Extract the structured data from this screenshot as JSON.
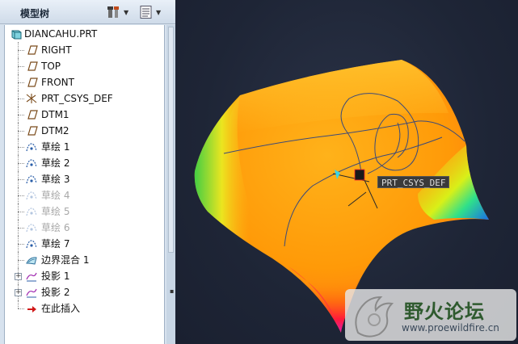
{
  "panel": {
    "title": "模型树",
    "settings_icon": "tree-settings-icon",
    "filter_icon": "tree-filter-icon"
  },
  "tree": {
    "root": {
      "label": "DIANCAHU.PRT",
      "icon": "part-icon"
    },
    "items": [
      {
        "label": "RIGHT",
        "icon": "datum-plane-icon",
        "suppressed": false,
        "expandable": false
      },
      {
        "label": "TOP",
        "icon": "datum-plane-icon",
        "suppressed": false,
        "expandable": false
      },
      {
        "label": "FRONT",
        "icon": "datum-plane-icon",
        "suppressed": false,
        "expandable": false
      },
      {
        "label": "PRT_CSYS_DEF",
        "icon": "coordinate-system-icon",
        "suppressed": false,
        "expandable": false
      },
      {
        "label": "DTM1",
        "icon": "datum-plane-icon",
        "suppressed": false,
        "expandable": false
      },
      {
        "label": "DTM2",
        "icon": "datum-plane-icon",
        "suppressed": false,
        "expandable": false
      },
      {
        "label": "草绘 1",
        "icon": "sketch-icon",
        "suppressed": false,
        "expandable": false
      },
      {
        "label": "草绘 2",
        "icon": "sketch-icon",
        "suppressed": false,
        "expandable": false
      },
      {
        "label": "草绘 3",
        "icon": "sketch-icon",
        "suppressed": false,
        "expandable": false
      },
      {
        "label": "草绘 4",
        "icon": "sketch-icon",
        "suppressed": true,
        "expandable": false
      },
      {
        "label": "草绘 5",
        "icon": "sketch-icon",
        "suppressed": true,
        "expandable": false
      },
      {
        "label": "草绘 6",
        "icon": "sketch-icon",
        "suppressed": true,
        "expandable": false
      },
      {
        "label": "草绘 7",
        "icon": "sketch-icon",
        "suppressed": false,
        "expandable": false
      },
      {
        "label": "边界混合 1",
        "icon": "boundary-blend-icon",
        "suppressed": false,
        "expandable": false
      },
      {
        "label": "投影 1",
        "icon": "projection-icon",
        "suppressed": false,
        "expandable": true
      },
      {
        "label": "投影 2",
        "icon": "projection-icon",
        "suppressed": false,
        "expandable": true
      },
      {
        "label": "在此插入",
        "icon": "insert-here-arrow-icon",
        "suppressed": false,
        "expandable": false
      }
    ]
  },
  "viewport": {
    "csys_label": "PRT_CSYS_DEF",
    "background": "#1f2637"
  },
  "watermark": {
    "title": "野火论坛",
    "url": "www.proewildfire.cn"
  },
  "colors": {
    "panel_bg": "#d7e2ee",
    "surface_main": "#ff9f0a",
    "surface_light": "#ffd12a",
    "curve": "#3b4a7a"
  }
}
